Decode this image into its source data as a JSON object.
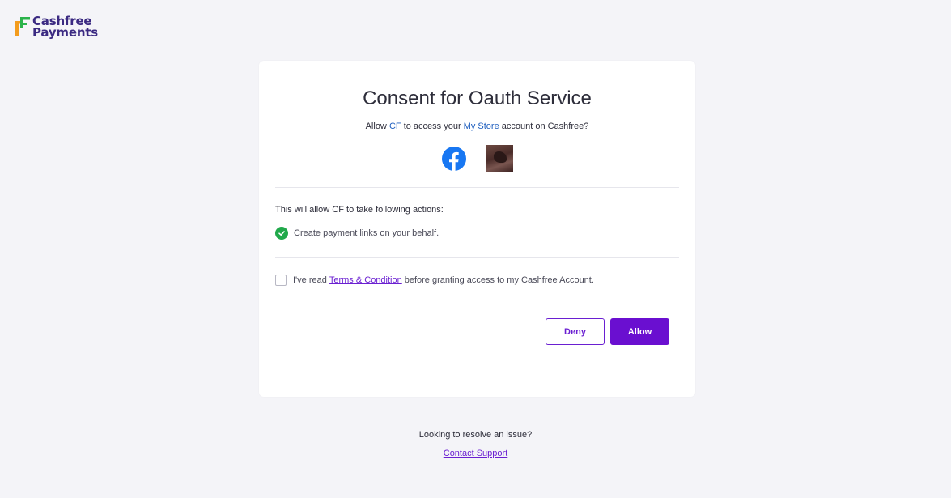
{
  "brand": {
    "line1": "Cashfree",
    "line2": "Payments",
    "colors": {
      "text": "#3b2a82",
      "mark_green": "#2bb34b",
      "mark_orange": "#f39c1e"
    }
  },
  "card": {
    "title": "Consent for Oauth Service",
    "subtitle": {
      "allow": "Allow",
      "app": "CF",
      "to_access": "to access your",
      "store": "My Store",
      "suffix": "account on Cashfree?"
    },
    "icons": [
      "facebook-icon",
      "store-avatar"
    ],
    "actions_heading": "This will allow CF to take following actions:",
    "actions": [
      {
        "label": "Create payment links on your behalf.",
        "icon": "check-circle-icon"
      }
    ],
    "consent": {
      "prefix": "I've read",
      "link": "Terms & Condition",
      "suffix": "before granting access to my Cashfree Account.",
      "checked": false
    },
    "buttons": {
      "deny": "Deny",
      "allow": "Allow"
    }
  },
  "footer": {
    "question": "Looking to resolve an issue?",
    "link": "Contact Support"
  },
  "colors": {
    "accent": "#6a0fd0",
    "success": "#21a94b",
    "highlight": "#1f5fbf",
    "background": "#f4f4f8"
  }
}
